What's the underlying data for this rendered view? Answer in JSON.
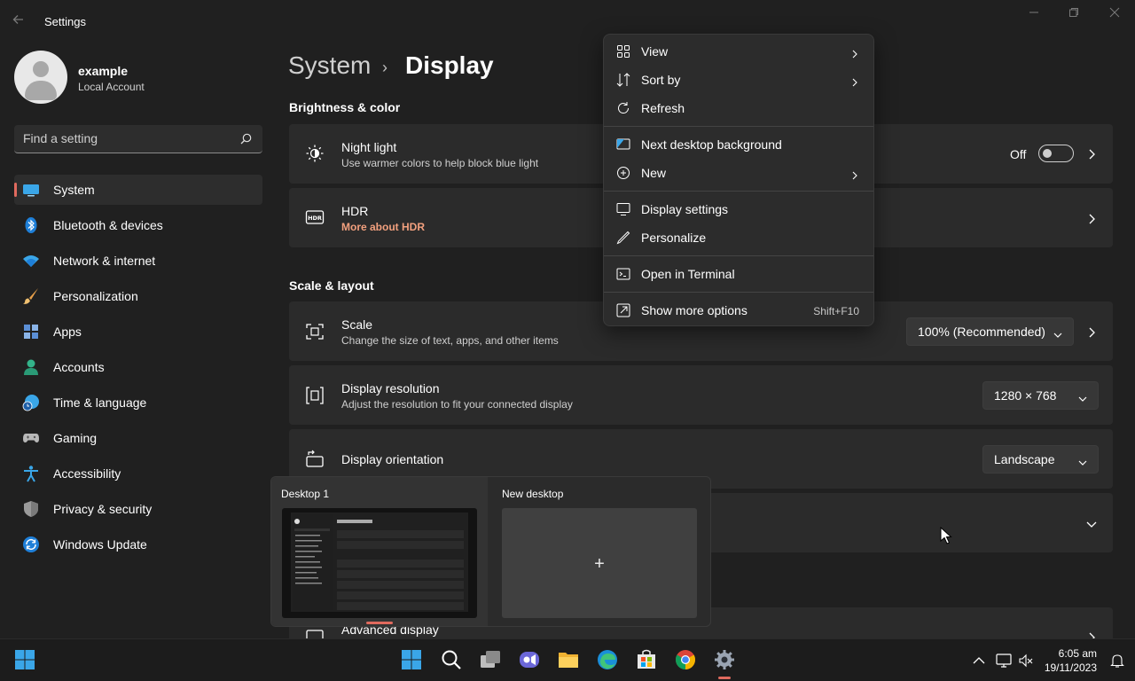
{
  "window": {
    "app_title": "Settings",
    "back_icon": "back-arrow-icon",
    "controls": [
      "minimize-icon",
      "maximize-icon",
      "close-icon"
    ]
  },
  "user": {
    "name": "example",
    "account_type": "Local Account"
  },
  "search": {
    "placeholder": "Find a setting",
    "value": ""
  },
  "sidebar": {
    "items": [
      {
        "label": "System",
        "icon": "system-icon",
        "active": true
      },
      {
        "label": "Bluetooth & devices",
        "icon": "bluetooth-icon"
      },
      {
        "label": "Network & internet",
        "icon": "wifi-icon"
      },
      {
        "label": "Personalization",
        "icon": "brush-icon"
      },
      {
        "label": "Apps",
        "icon": "apps-icon"
      },
      {
        "label": "Accounts",
        "icon": "accounts-icon"
      },
      {
        "label": "Time & language",
        "icon": "time-language-icon"
      },
      {
        "label": "Gaming",
        "icon": "gamepad-icon"
      },
      {
        "label": "Accessibility",
        "icon": "accessibility-icon"
      },
      {
        "label": "Privacy & security",
        "icon": "shield-icon"
      },
      {
        "label": "Windows Update",
        "icon": "windows-update-icon"
      }
    ]
  },
  "breadcrumb": {
    "parent": "System",
    "separator": "›",
    "current": "Display"
  },
  "sections": {
    "brightness": "Brightness & color",
    "scale_layout": "Scale & layout"
  },
  "cards": {
    "night_light": {
      "title": "Night light",
      "subtitle": "Use warmer colors to help block blue light",
      "state_label": "Off",
      "on": false
    },
    "hdr": {
      "title": "HDR",
      "link": "More about HDR"
    },
    "scale": {
      "title": "Scale",
      "subtitle": "Change the size of text, apps, and other items",
      "value": "100% (Recommended)"
    },
    "resolution": {
      "title": "Display resolution",
      "subtitle": "Adjust the resolution to fit your connected display",
      "value": "1280 × 768"
    },
    "orientation": {
      "title": "Display orientation",
      "value": "Landscape"
    },
    "advanced": {
      "title": "Advanced display"
    }
  },
  "context_menu": {
    "items": [
      {
        "label": "View",
        "icon": "view-grid-icon",
        "submenu": true
      },
      {
        "label": "Sort by",
        "icon": "sort-icon",
        "submenu": true
      },
      {
        "label": "Refresh",
        "icon": "refresh-icon"
      },
      {
        "label": "Next desktop background",
        "icon": "desktop-background-icon"
      },
      {
        "label": "New",
        "icon": "new-plus-icon",
        "submenu": true
      },
      {
        "label": "Display settings",
        "icon": "display-settings-icon"
      },
      {
        "label": "Personalize",
        "icon": "pen-icon"
      },
      {
        "label": "Open in Terminal",
        "icon": "terminal-icon"
      },
      {
        "label": "Show more options",
        "icon": "more-options-icon",
        "shortcut": "Shift+F10"
      }
    ]
  },
  "task_view": {
    "desktop1_label": "Desktop 1",
    "new_desktop_label": "New desktop",
    "plus": "+"
  },
  "taskbar": {
    "icons": [
      "start-icon",
      "taskbar-search-icon",
      "task-view-icon",
      "teams-chat-icon",
      "file-explorer-icon",
      "edge-icon",
      "store-icon",
      "chrome-icon",
      "settings-gear-icon"
    ],
    "tray_icons": [
      "tray-chevron-up-icon",
      "network-icon",
      "volume-muted-icon"
    ],
    "time": "6:05 am",
    "date": "19/11/2023"
  },
  "colors": {
    "accent": "#e06a5e",
    "link": "#f2a07e",
    "background": "#202020",
    "card": "#2b2b2b"
  }
}
